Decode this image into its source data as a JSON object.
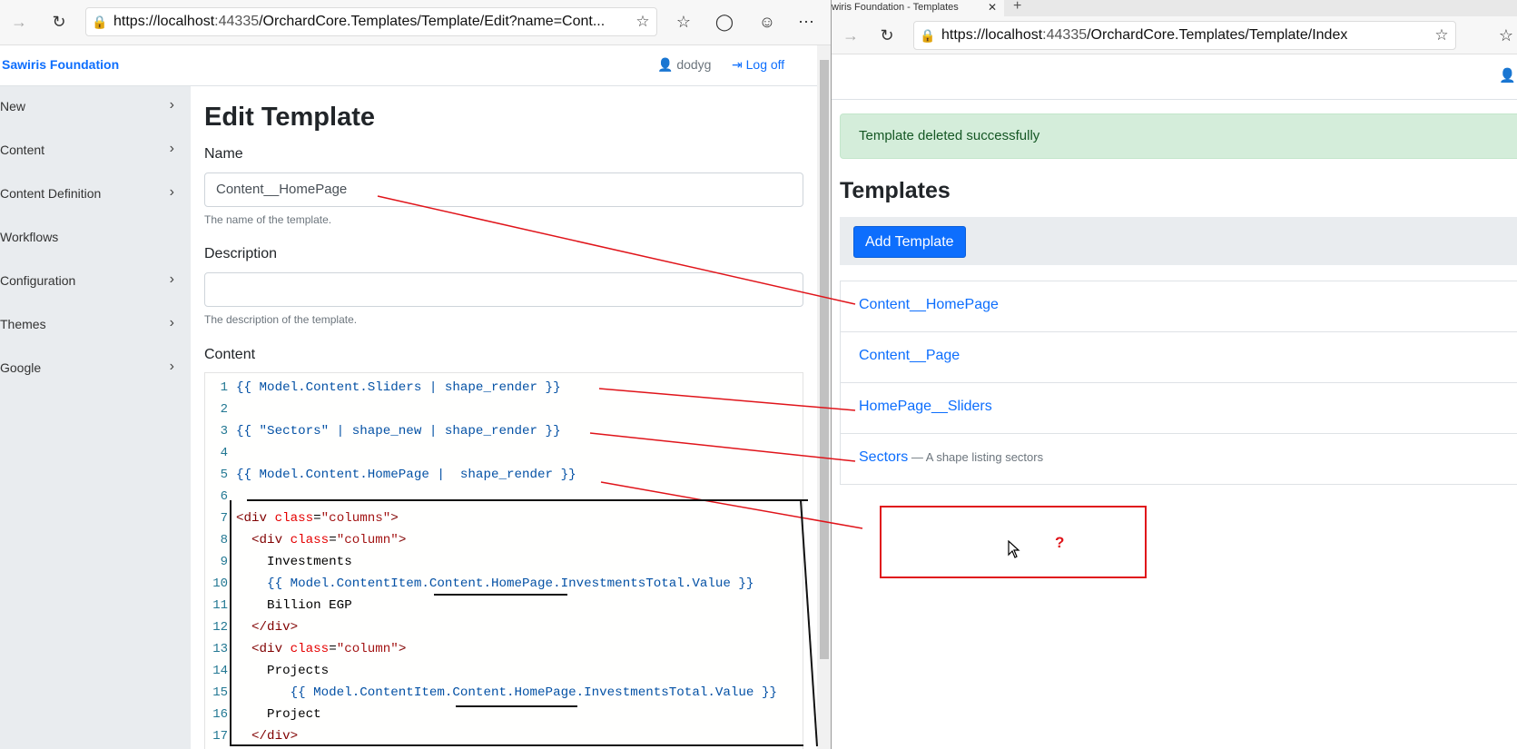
{
  "left": {
    "url": {
      "host": "https://localhost",
      "port": ":44335",
      "path": "/OrchardCore.Templates/Template/Edit?name=Cont..."
    },
    "brand": "Sawiris Foundation",
    "user": "dodyg",
    "logoff": "Log off",
    "menu": [
      {
        "label": "New",
        "arrow": true
      },
      {
        "label": "Content",
        "arrow": true
      },
      {
        "label": "Content Definition",
        "arrow": true
      },
      {
        "label": "Workflows",
        "arrow": false
      },
      {
        "label": "Configuration",
        "arrow": true
      },
      {
        "label": "Themes",
        "arrow": true
      },
      {
        "label": "Google",
        "arrow": true
      }
    ],
    "title": "Edit Template",
    "name_label": "Name",
    "name_value": "Content__HomePage",
    "name_hint": "The name of the template.",
    "desc_label": "Description",
    "desc_value": "",
    "desc_hint": "The description of the template.",
    "content_label": "Content",
    "line_numbers": [
      "1",
      "2",
      "3",
      "4",
      "5",
      "6",
      "7",
      "8",
      "9",
      "10",
      "11",
      "12",
      "13",
      "14",
      "15",
      "16",
      "17"
    ]
  },
  "right": {
    "tab_title": "wiris Foundation - Templates",
    "url": {
      "host": "https://localhost",
      "port": ":44335",
      "path": "/OrchardCore.Templates/Template/Index"
    },
    "alert": "Template deleted successfully",
    "heading": "Templates",
    "add_button": "Add Template",
    "templates": [
      {
        "name": "Content__HomePage",
        "desc": ""
      },
      {
        "name": "Content__Page",
        "desc": ""
      },
      {
        "name": "HomePage__Sliders",
        "desc": ""
      },
      {
        "name": "Sectors",
        "desc": " — A shape listing sectors"
      }
    ],
    "question_mark": "?"
  },
  "colors": {
    "link": "#0d6efd",
    "annotation": "#e0141a",
    "alert_bg": "#d4edda",
    "sidebar_bg": "#e9ecef"
  }
}
